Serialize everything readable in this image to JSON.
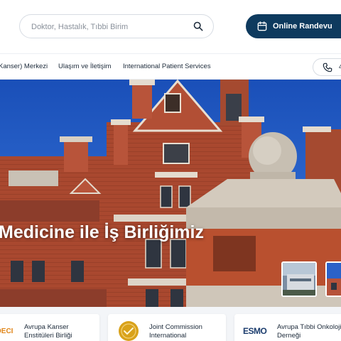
{
  "header": {
    "search": {
      "placeholder": "Doktor, Hastalık, Tıbbi Birim"
    },
    "appointment_button": {
      "label": "Online Randevu"
    }
  },
  "nav": {
    "items": [
      {
        "label": "Kanser) Merkezi"
      },
      {
        "label": "Ulaşım ve İletişim"
      },
      {
        "label": "International Patient Services"
      }
    ],
    "phone": {
      "text": "4"
    }
  },
  "hero": {
    "title": "Medicine ile İş Birliğimiz"
  },
  "partners": [
    {
      "name": "Avrupa Kanser Enstitüleri Birliği",
      "line1": "Avrupa Kanser",
      "line2": "Enstitüleri Birliği",
      "logo_text": "OECI"
    },
    {
      "name": "Joint Commission International",
      "line1": "Joint Commission",
      "line2": "International",
      "logo_text": ""
    },
    {
      "name": "Avrupa Tıbbi Onkoloji Derneği",
      "line1": "Avrupa Tıbbi Onkoloji",
      "line2": "Derneği",
      "logo_text": "ESMO"
    }
  ],
  "colors": {
    "primary_navy": "#0e3a5e",
    "sky_blue": "#1f5fc4",
    "brick": "#a9482f",
    "gold": "#d9a21b"
  },
  "icons": {
    "search": "search-icon",
    "calendar": "calendar-icon",
    "phone": "phone-icon"
  }
}
